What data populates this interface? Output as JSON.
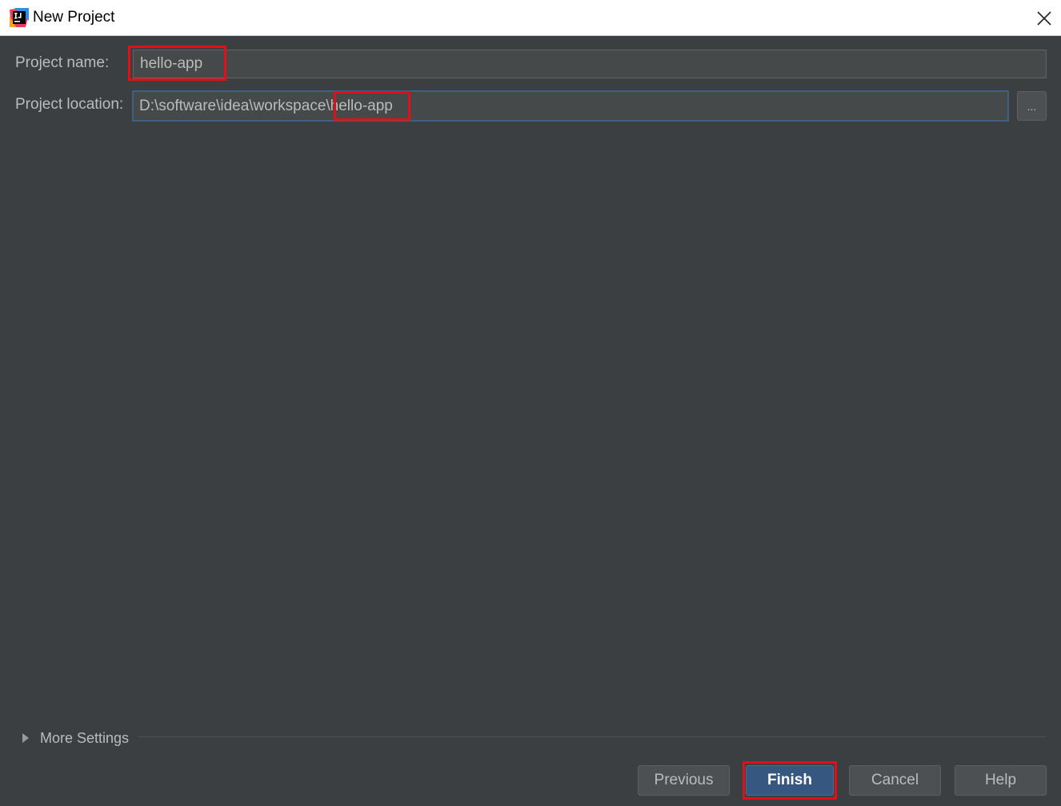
{
  "window": {
    "title": "New Project",
    "app_icon": "intellij-idea-icon",
    "close_icon": "close-icon"
  },
  "form": {
    "project_name_label": "Project name:",
    "project_name_value": "hello-app",
    "project_location_label": "Project location:",
    "project_location_prefix": "D:\\software\\idea\\workspace\\",
    "project_location_suffix": "hello-app",
    "browse_label": "..."
  },
  "more_settings": {
    "label": "More Settings",
    "expand_icon": "triangle-right-icon"
  },
  "buttons": {
    "previous": "Previous",
    "finish": "Finish",
    "cancel": "Cancel",
    "help": "Help"
  },
  "colors": {
    "background": "#3c3f41",
    "field_background": "#45494a",
    "primary_button": "#365880",
    "highlight": "#e0101a"
  }
}
